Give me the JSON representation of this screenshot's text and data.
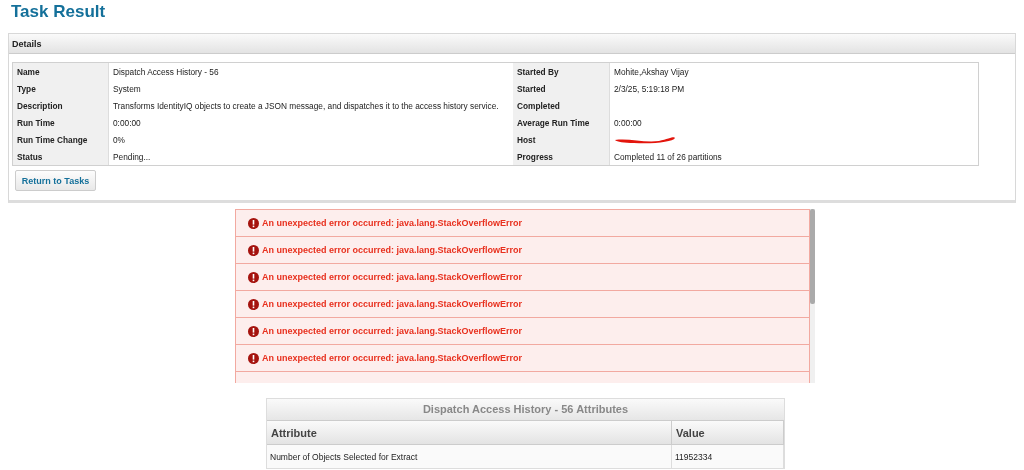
{
  "page_title": "Task Result",
  "details": {
    "title": "Details",
    "left": [
      {
        "label": "Name",
        "value": "Dispatch Access History - 56"
      },
      {
        "label": "Type",
        "value": "System"
      },
      {
        "label": "Description",
        "value": "Transforms IdentityIQ objects to create a JSON message, and dispatches it to the access history service."
      },
      {
        "label": "Run Time",
        "value": "0:00:00"
      },
      {
        "label": "Run Time Change",
        "value": "0%"
      },
      {
        "label": "Status",
        "value": "Pending..."
      }
    ],
    "right": [
      {
        "label": "Started By",
        "value": "Mohite,Akshay Vijay"
      },
      {
        "label": "Started",
        "value": "2/3/25, 5:19:18 PM"
      },
      {
        "label": "Completed"
      },
      {
        "label": "Average Run Time",
        "value": "0:00:00"
      },
      {
        "label": "Host",
        "kind": "redacted"
      },
      {
        "label": "Progress",
        "value": "Completed 11 of 26 partitions"
      }
    ],
    "button": "Return to Tasks"
  },
  "errors": [
    "An unexpected error occurred: java.lang.StackOverflowError",
    "An unexpected error occurred: java.lang.StackOverflowError",
    "An unexpected error occurred: java.lang.StackOverflowError",
    "An unexpected error occurred: java.lang.StackOverflowError",
    "An unexpected error occurred: java.lang.StackOverflowError",
    "An unexpected error occurred: java.lang.StackOverflowError"
  ],
  "attributes": {
    "title": "Dispatch Access History - 56 Attributes",
    "columns": [
      "Attribute",
      "Value"
    ],
    "rows": [
      [
        "Number of Objects Selected for Extract",
        "11952334"
      ]
    ]
  }
}
